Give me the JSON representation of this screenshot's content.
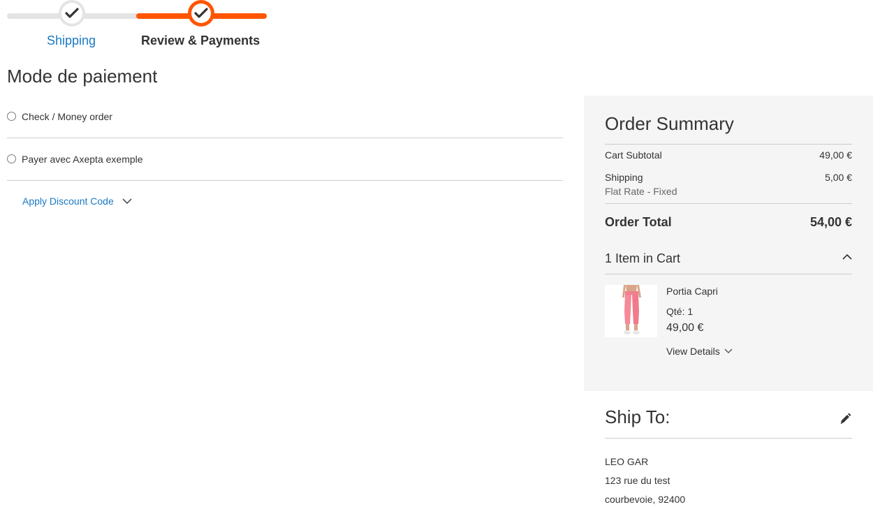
{
  "progress": {
    "steps": [
      {
        "label": "Shipping",
        "state": "complete"
      },
      {
        "label": "Review & Payments",
        "state": "active"
      }
    ],
    "active_color": "#ff5501",
    "link_color": "#1979c3"
  },
  "payment": {
    "title": "Mode de paiement",
    "methods": [
      {
        "label": "Check / Money order",
        "selected": false
      },
      {
        "label": "Payer avec Axepta exemple",
        "selected": false
      }
    ],
    "discount_label": "Apply Discount Code"
  },
  "summary": {
    "title": "Order Summary",
    "cart_subtotal_label": "Cart Subtotal",
    "cart_subtotal_value": "49,00 €",
    "shipping_label": "Shipping",
    "shipping_value": "5,00 €",
    "shipping_method": "Flat Rate - Fixed",
    "order_total_label": "Order Total",
    "order_total_value": "54,00 €",
    "items_title": "1 Item in Cart",
    "items": [
      {
        "name": "Portia Capri",
        "qty": "Qté: 1",
        "price": "49,00 €",
        "details_label": "View Details"
      }
    ]
  },
  "ship_to": {
    "title": "Ship To:",
    "address": [
      "LEO GAR",
      "123 rue du test",
      "courbevoie, 92400"
    ]
  },
  "icons": [
    "check-icon",
    "chevron-down-icon",
    "chevron-up-icon",
    "pencil-icon",
    "product-thumbnail"
  ]
}
